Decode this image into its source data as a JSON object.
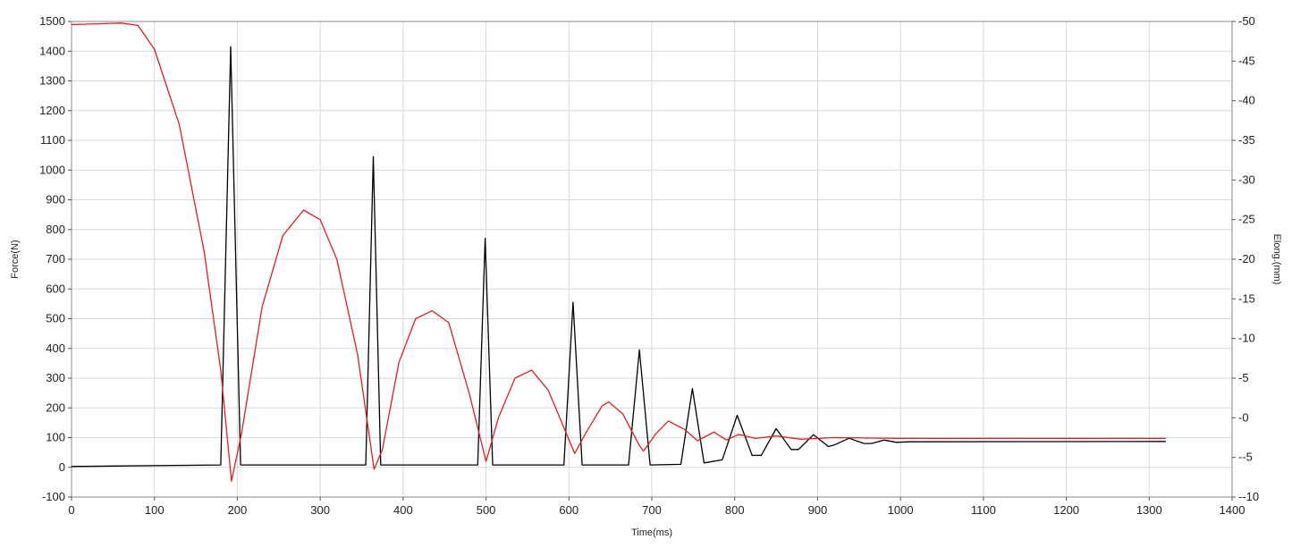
{
  "chart_data": {
    "type": "line",
    "xlabel": "Time(ms)",
    "ylabel_left": "Force(N)",
    "ylabel_right": "Elong.(mm)",
    "xlim": [
      0,
      1400
    ],
    "ylim_left": [
      -100,
      1500
    ],
    "ylim_right": [
      -10,
      50
    ],
    "x_ticks": [
      0,
      100,
      200,
      300,
      400,
      500,
      600,
      700,
      800,
      900,
      1000,
      1100,
      1200,
      1300,
      1400
    ],
    "y_ticks_left": [
      -100,
      0,
      100,
      200,
      300,
      400,
      500,
      600,
      700,
      800,
      900,
      1000,
      1100,
      1200,
      1300,
      1400,
      1500
    ],
    "y_ticks_right": [
      -10,
      -5,
      0,
      5,
      10,
      15,
      20,
      25,
      30,
      35,
      40,
      45,
      50
    ],
    "grid": true,
    "series": [
      {
        "axis": "left",
        "color": "#000000",
        "baseline": 10,
        "x": [
          0,
          180,
          192,
          204,
          355,
          364,
          373,
          490,
          499,
          508,
          594,
          605,
          616,
          672,
          685,
          698,
          735,
          749,
          763,
          785,
          803,
          821,
          832,
          850,
          868,
          877,
          895,
          913,
          920,
          938,
          956,
          965,
          980,
          995,
          1010,
          1320
        ],
        "values": [
          3,
          8,
          1415,
          8,
          8,
          1045,
          8,
          8,
          770,
          8,
          8,
          555,
          8,
          8,
          395,
          8,
          10,
          265,
          15,
          25,
          175,
          40,
          40,
          130,
          60,
          60,
          110,
          70,
          75,
          98,
          80,
          80,
          92,
          84,
          86,
          87
        ]
      },
      {
        "axis": "right",
        "color": "#e02020",
        "x": [
          0,
          60,
          80,
          100,
          130,
          160,
          180,
          193,
          205,
          230,
          255,
          280,
          300,
          320,
          345,
          365,
          375,
          395,
          415,
          435,
          455,
          480,
          500,
          515,
          535,
          555,
          575,
          595,
          607,
          620,
          640,
          648,
          665,
          685,
          690,
          705,
          720,
          740,
          755,
          775,
          790,
          805,
          825,
          850,
          880,
          920,
          1000,
          1100,
          1320
        ],
        "values": [
          49.6,
          49.8,
          49.5,
          46.5,
          37,
          21,
          6,
          -8,
          -2,
          14,
          23,
          26.2,
          25,
          20,
          8,
          -6.5,
          -4,
          7,
          12.5,
          13.5,
          12,
          3,
          -5.5,
          0,
          5,
          6,
          3.5,
          -1.5,
          -4.5,
          -2,
          1.5,
          2,
          0.5,
          -3.5,
          -4.2,
          -2,
          -0.4,
          -1.5,
          -2.9,
          -1.8,
          -2.8,
          -2.1,
          -2.6,
          -2.3,
          -2.7,
          -2.5,
          -2.6,
          -2.6,
          -2.6
        ]
      }
    ]
  }
}
